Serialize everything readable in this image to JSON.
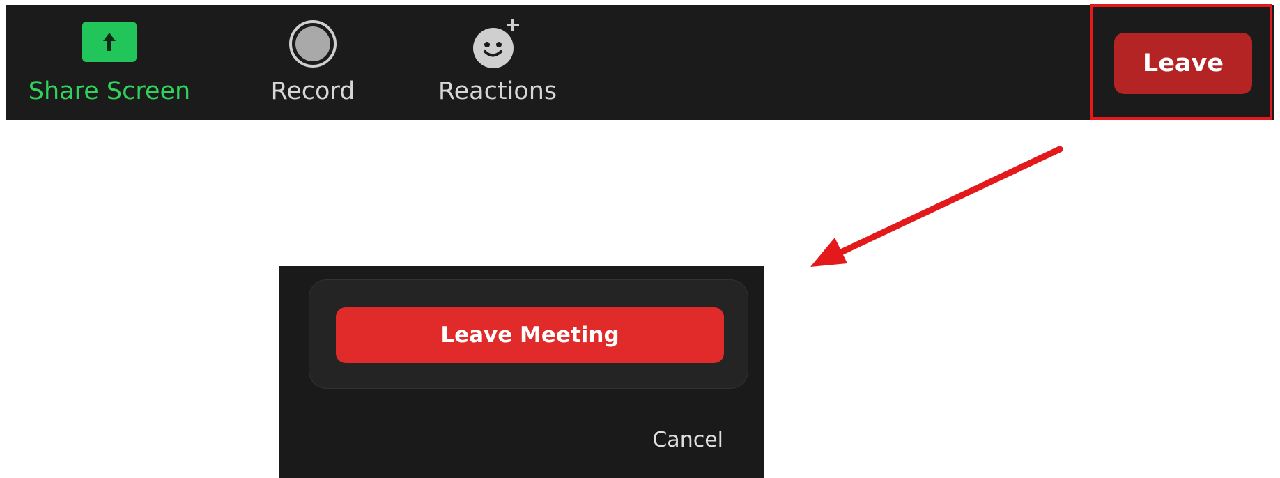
{
  "toolbar": {
    "share_screen": {
      "label": "Share Screen",
      "icon": "share-screen-icon",
      "color": "#2fd35b"
    },
    "record": {
      "label": "Record",
      "icon": "record-icon"
    },
    "reactions": {
      "label": "Reactions",
      "icon": "reactions-icon"
    },
    "leave": {
      "label": "Leave",
      "color": "#b42424"
    }
  },
  "dialog": {
    "leave_meeting_label": "Leave Meeting",
    "leave_meeting_color": "#e12a2a",
    "cancel_label": "Cancel"
  },
  "annotation": {
    "highlight_color": "#e3191c",
    "arrow_color": "#e3191c"
  }
}
